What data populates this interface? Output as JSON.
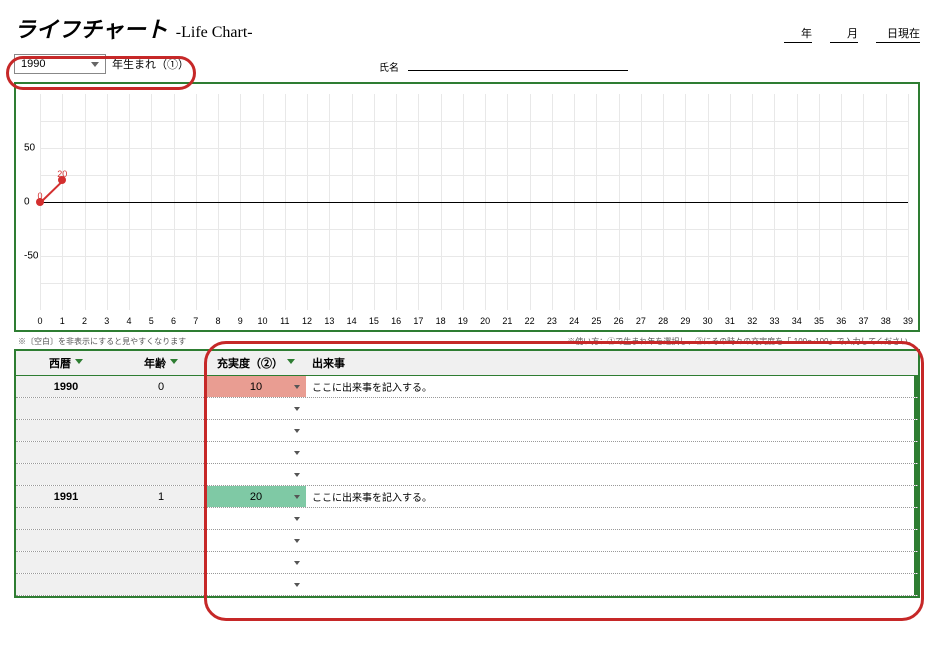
{
  "header": {
    "title_ja": "ライフチャート",
    "title_en": "-Life Chart-",
    "date_year_unit": "年",
    "date_month_unit": "月",
    "date_day_suffix": "日現在"
  },
  "meta": {
    "birth_year_selected": "1990",
    "birth_year_suffix": "年生まれ（①）",
    "name_label": "氏名"
  },
  "notes": {
    "left": "※〔空白〕を非表示にすると見やすくなります",
    "right": "※使い方：①で生まれ年を選択し、②にその時々の充実度を「-100〜100」で入力してください。"
  },
  "table": {
    "headers": {
      "year": "西暦",
      "age": "年齢",
      "score": "充実度（②）",
      "event": "出来事"
    },
    "placeholder_event": "ここに出来事を記入する。",
    "rows": [
      {
        "year": "1990",
        "age": "0",
        "score": "10",
        "score_color": "red",
        "event": "ここに出来事を記入する。"
      },
      {
        "year": "",
        "age": "",
        "score": "",
        "score_color": "",
        "event": ""
      },
      {
        "year": "",
        "age": "",
        "score": "",
        "score_color": "",
        "event": ""
      },
      {
        "year": "",
        "age": "",
        "score": "",
        "score_color": "",
        "event": ""
      },
      {
        "year": "",
        "age": "",
        "score": "",
        "score_color": "",
        "event": ""
      },
      {
        "year": "1991",
        "age": "1",
        "score": "20",
        "score_color": "green",
        "event": "ここに出来事を記入する。"
      },
      {
        "year": "",
        "age": "",
        "score": "",
        "score_color": "",
        "event": ""
      },
      {
        "year": "",
        "age": "",
        "score": "",
        "score_color": "",
        "event": ""
      },
      {
        "year": "",
        "age": "",
        "score": "",
        "score_color": "",
        "event": ""
      },
      {
        "year": "",
        "age": "",
        "score": "",
        "score_color": "",
        "event": ""
      }
    ]
  },
  "chart_data": {
    "type": "line",
    "xlabel": "",
    "ylabel": "",
    "ylim": [
      -100,
      100
    ],
    "y_ticks": [
      -50,
      0,
      50
    ],
    "x_ticks": [
      0,
      1,
      2,
      3,
      4,
      5,
      6,
      7,
      8,
      9,
      10,
      11,
      12,
      13,
      14,
      15,
      16,
      17,
      18,
      19,
      20,
      21,
      22,
      23,
      24,
      25,
      26,
      27,
      28,
      29,
      30,
      31,
      32,
      33,
      34,
      35,
      36,
      37,
      38,
      39
    ],
    "series": [
      {
        "name": "充実度",
        "color": "#d32f2f",
        "x": [
          0,
          1
        ],
        "y": [
          0,
          20
        ],
        "labels": [
          "0",
          "20"
        ]
      }
    ]
  }
}
